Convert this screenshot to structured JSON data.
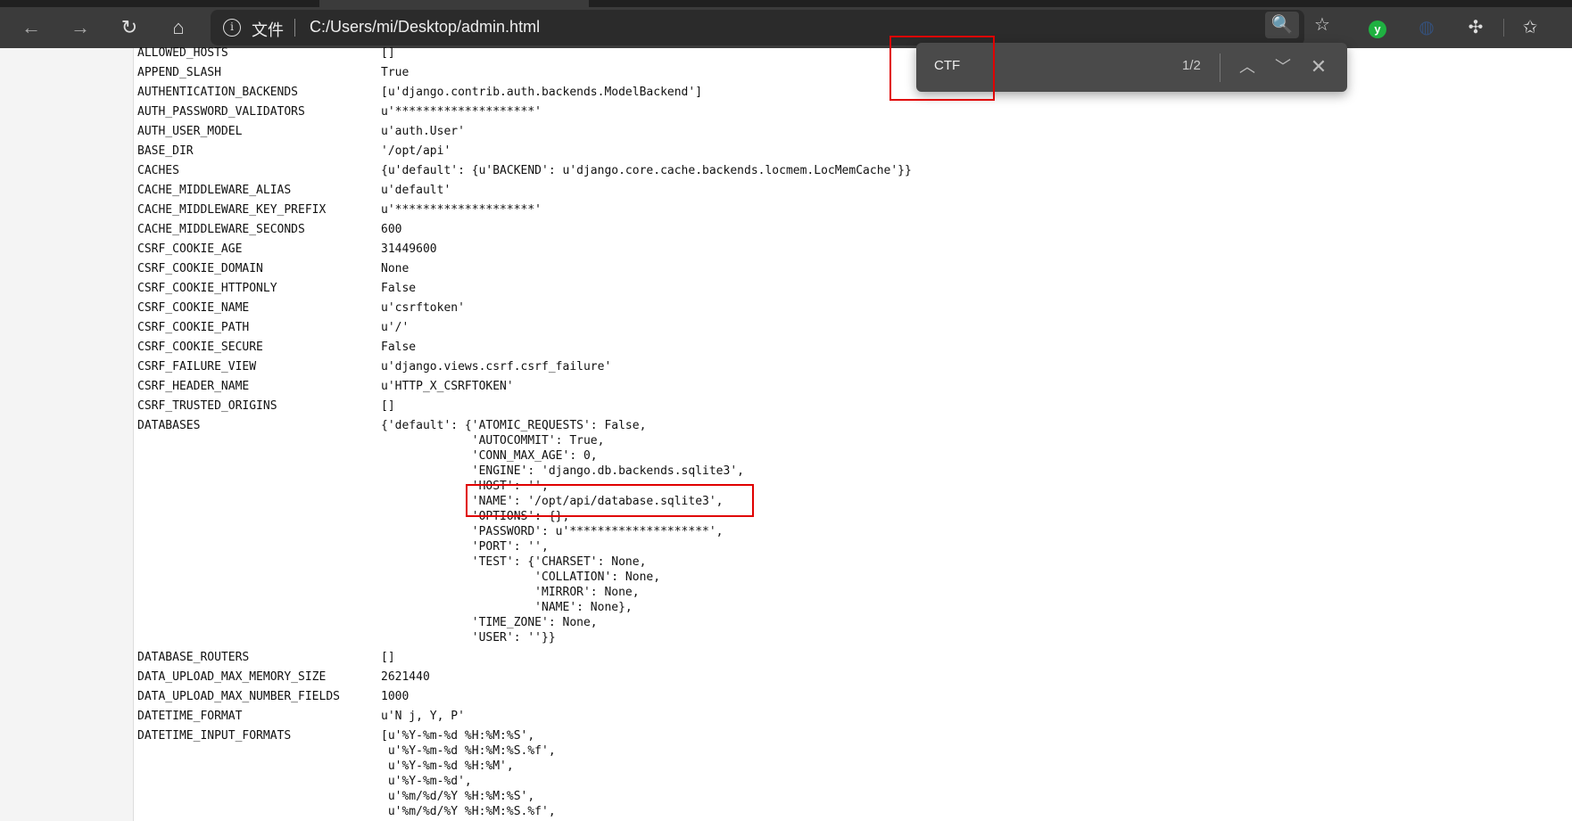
{
  "browser": {
    "info_label": "文件",
    "url": "C:/Users/mi/Desktop/admin.html"
  },
  "find_bar": {
    "query": "CTF",
    "count": "1/2"
  },
  "settings": [
    {
      "key": "ALLOWED_HOSTS",
      "value": "[]"
    },
    {
      "key": "APPEND_SLASH",
      "value": "True"
    },
    {
      "key": "AUTHENTICATION_BACKENDS",
      "value": "[u'django.contrib.auth.backends.ModelBackend']"
    },
    {
      "key": "AUTH_PASSWORD_VALIDATORS",
      "value": "u'********************'"
    },
    {
      "key": "AUTH_USER_MODEL",
      "value": "u'auth.User'"
    },
    {
      "key": "BASE_DIR",
      "value": "'/opt/api'"
    },
    {
      "key": "CACHES",
      "value": "{u'default': {u'BACKEND': u'django.core.cache.backends.locmem.LocMemCache'}}"
    },
    {
      "key": "CACHE_MIDDLEWARE_ALIAS",
      "value": "u'default'"
    },
    {
      "key": "CACHE_MIDDLEWARE_KEY_PREFIX",
      "value": "u'********************'"
    },
    {
      "key": "CACHE_MIDDLEWARE_SECONDS",
      "value": "600"
    },
    {
      "key": "CSRF_COOKIE_AGE",
      "value": "31449600"
    },
    {
      "key": "CSRF_COOKIE_DOMAIN",
      "value": "None"
    },
    {
      "key": "CSRF_COOKIE_HTTPONLY",
      "value": "False"
    },
    {
      "key": "CSRF_COOKIE_NAME",
      "value": "u'csrftoken'"
    },
    {
      "key": "CSRF_COOKIE_PATH",
      "value": "u'/'"
    },
    {
      "key": "CSRF_COOKIE_SECURE",
      "value": "False"
    },
    {
      "key": "CSRF_FAILURE_VIEW",
      "value": "u'django.views.csrf.csrf_failure'"
    },
    {
      "key": "CSRF_HEADER_NAME",
      "value": "u'HTTP_X_CSRFTOKEN'"
    },
    {
      "key": "CSRF_TRUSTED_ORIGINS",
      "value": "[]"
    },
    {
      "key": "DATABASES",
      "value": "{'default': {'ATOMIC_REQUESTS': False,\n             'AUTOCOMMIT': True,\n             'CONN_MAX_AGE': 0,\n             'ENGINE': 'django.db.backends.sqlite3',\n             'HOST': '',\n             'NAME': '/opt/api/database.sqlite3',\n             'OPTIONS': {},\n             'PASSWORD': u'********************',\n             'PORT': '',\n             'TEST': {'CHARSET': None,\n                      'COLLATION': None,\n                      'MIRROR': None,\n                      'NAME': None},\n             'TIME_ZONE': None,\n             'USER': ''}}"
    },
    {
      "key": "DATABASE_ROUTERS",
      "value": "[]"
    },
    {
      "key": "DATA_UPLOAD_MAX_MEMORY_SIZE",
      "value": "2621440"
    },
    {
      "key": "DATA_UPLOAD_MAX_NUMBER_FIELDS",
      "value": "1000"
    },
    {
      "key": "DATETIME_FORMAT",
      "value": "u'N j, Y, P'"
    },
    {
      "key": "DATETIME_INPUT_FORMATS",
      "value": "[u'%Y-%m-%d %H:%M:%S',\n u'%Y-%m-%d %H:%M:%S.%f',\n u'%Y-%m-%d %H:%M',\n u'%Y-%m-%d',\n u'%m/%d/%Y %H:%M:%S',\n u'%m/%d/%Y %H:%M:%S.%f',"
    }
  ],
  "highlight_color": "#e00000"
}
